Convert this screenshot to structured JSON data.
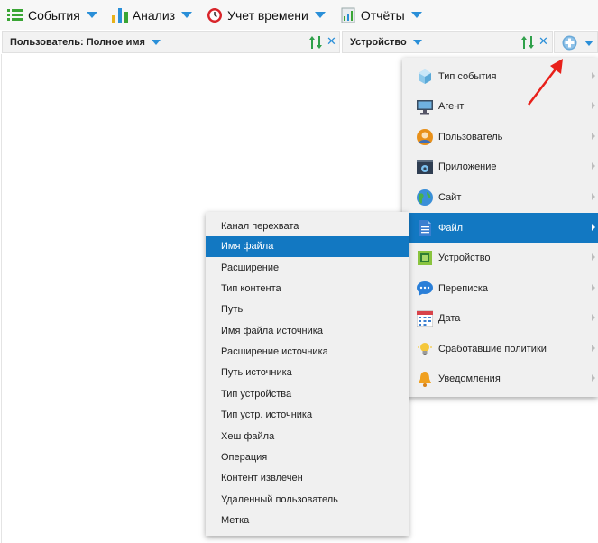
{
  "toolbar": {
    "events": "События",
    "analysis": "Анализ",
    "time": "Учет времени",
    "reports": "Отчёты"
  },
  "columns": {
    "user": "Пользователь: Полное имя",
    "device": "Устройство"
  },
  "menu": {
    "items": [
      {
        "label": "Тип события",
        "icon": "cube-icon"
      },
      {
        "label": "Агент",
        "icon": "monitor-icon"
      },
      {
        "label": "Пользователь",
        "icon": "user-icon"
      },
      {
        "label": "Приложение",
        "icon": "app-gear-icon"
      },
      {
        "label": "Сайт",
        "icon": "globe-icon"
      },
      {
        "label": "Файл",
        "icon": "file-icon"
      },
      {
        "label": "Устройство",
        "icon": "chip-icon"
      },
      {
        "label": "Переписка",
        "icon": "chat-icon"
      },
      {
        "label": "Дата",
        "icon": "calendar-icon"
      },
      {
        "label": "Сработавшие политики",
        "icon": "lightbulb-icon"
      },
      {
        "label": "Уведомления",
        "icon": "bell-icon"
      }
    ],
    "active_index": 5
  },
  "submenu": {
    "items": [
      "Канал перехвата",
      "Имя файла",
      "Расширение",
      "Тип контента",
      "Путь",
      "Имя файла источника",
      "Расширение источника",
      "Путь источника",
      "Тип устройства",
      "Тип устр. источника",
      "Хеш файла",
      "Операция",
      "Контент извлечен",
      "Удаленный пользователь",
      "Метка"
    ],
    "active_index": 1
  },
  "colors": {
    "accent": "#2a8fd8",
    "highlight": "#1278c2",
    "annotation_arrow": "#e8201a"
  }
}
